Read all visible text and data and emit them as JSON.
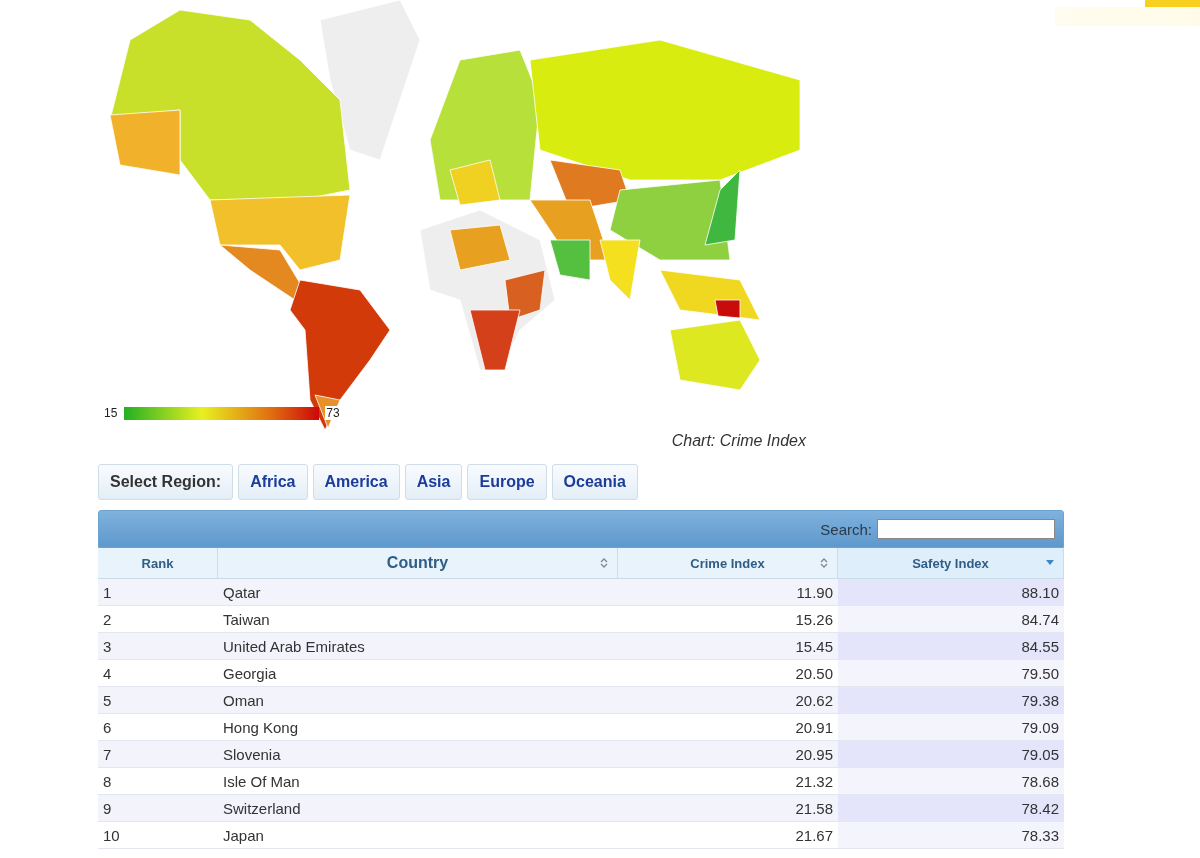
{
  "map": {
    "legend_min": "15",
    "legend_max": "73",
    "caption": "Chart: Crime Index"
  },
  "region_bar": {
    "label": "Select Region:",
    "buttons": [
      "Africa",
      "America",
      "Asia",
      "Europe",
      "Oceania"
    ]
  },
  "table": {
    "search_label": "Search:",
    "columns": [
      {
        "label": "Rank",
        "kind": "text",
        "sortable": false,
        "selected": false
      },
      {
        "label": "Country",
        "kind": "text",
        "sortable": true,
        "selected": false
      },
      {
        "label": "Crime Index",
        "kind": "number",
        "sortable": true,
        "selected": false
      },
      {
        "label": "Safety Index",
        "kind": "number",
        "sortable": true,
        "selected": true
      }
    ],
    "rows": [
      [
        "1",
        "Qatar",
        "11.90",
        "88.10"
      ],
      [
        "2",
        "Taiwan",
        "15.26",
        "84.74"
      ],
      [
        "3",
        "United Arab Emirates",
        "15.45",
        "84.55"
      ],
      [
        "4",
        "Georgia",
        "20.50",
        "79.50"
      ],
      [
        "5",
        "Oman",
        "20.62",
        "79.38"
      ],
      [
        "6",
        "Hong Kong",
        "20.91",
        "79.09"
      ],
      [
        "7",
        "Slovenia",
        "20.95",
        "79.05"
      ],
      [
        "8",
        "Isle Of Man",
        "21.32",
        "78.68"
      ],
      [
        "9",
        "Switzerland",
        "21.58",
        "78.42"
      ],
      [
        "10",
        "Japan",
        "21.67",
        "78.33"
      ]
    ]
  }
}
